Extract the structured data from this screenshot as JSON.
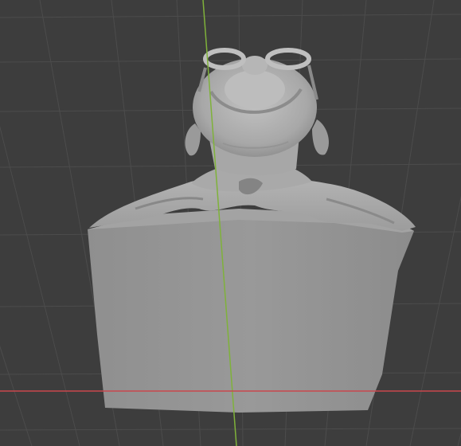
{
  "app": {
    "name": "3D viewport",
    "view": "perspective-from-below"
  },
  "viewport": {
    "background_color": "#3d3d3d",
    "grid_color": "#4c4c4c",
    "grid_minor_color": "#444444"
  },
  "axes": {
    "x_axis_color": "#c9474d",
    "y_axis_color": "#7fb23a"
  },
  "model": {
    "object_name": "bust-sculpt",
    "base_color": "#9a9a9a",
    "shade_light": "#b8b8b8",
    "shade_dark": "#6e6e6e",
    "features": [
      "head",
      "goggles",
      "ears",
      "neck",
      "shoulders",
      "base-block"
    ]
  }
}
